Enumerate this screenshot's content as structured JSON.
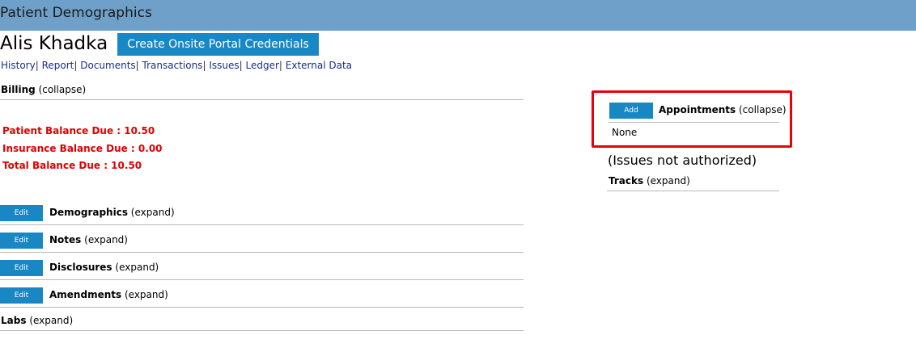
{
  "header": {
    "title": "Patient Demographics"
  },
  "patient": {
    "name": "Alis Khadka",
    "portal_button_label": "Create Onsite Portal Credentials"
  },
  "nav": {
    "links": [
      "History",
      "Report",
      "Documents",
      "Transactions",
      "Issues",
      "Ledger",
      "External Data"
    ],
    "separator": "|"
  },
  "billing": {
    "title": "Billing",
    "toggle": "(collapse)",
    "patient_balance": "Patient Balance Due : 10.50",
    "insurance_balance": "Insurance Balance Due : 0.00",
    "total_balance": "Total Balance Due : 10.50"
  },
  "sections": [
    {
      "title": "Demographics",
      "toggle": "(expand)",
      "edit_label": "Edit"
    },
    {
      "title": "Notes",
      "toggle": "(expand)",
      "edit_label": "Edit"
    },
    {
      "title": "Disclosures",
      "toggle": "(expand)",
      "edit_label": "Edit"
    },
    {
      "title": "Amendments",
      "toggle": "(expand)",
      "edit_label": "Edit"
    }
  ],
  "labs": {
    "title": "Labs",
    "toggle": "(expand)"
  },
  "appointments": {
    "add_label": "Add",
    "title": "Appointments",
    "toggle": "(collapse)",
    "value": "None"
  },
  "issues_notice": "(Issues not authorized)",
  "tracks": {
    "title": "Tracks",
    "toggle": "(expand)"
  },
  "colors": {
    "header_bg": "#6fa0c9",
    "button_bg": "#1a87c5",
    "balance_text": "#e00000",
    "highlight_border": "#e8000b",
    "link": "#1a2d8a"
  }
}
